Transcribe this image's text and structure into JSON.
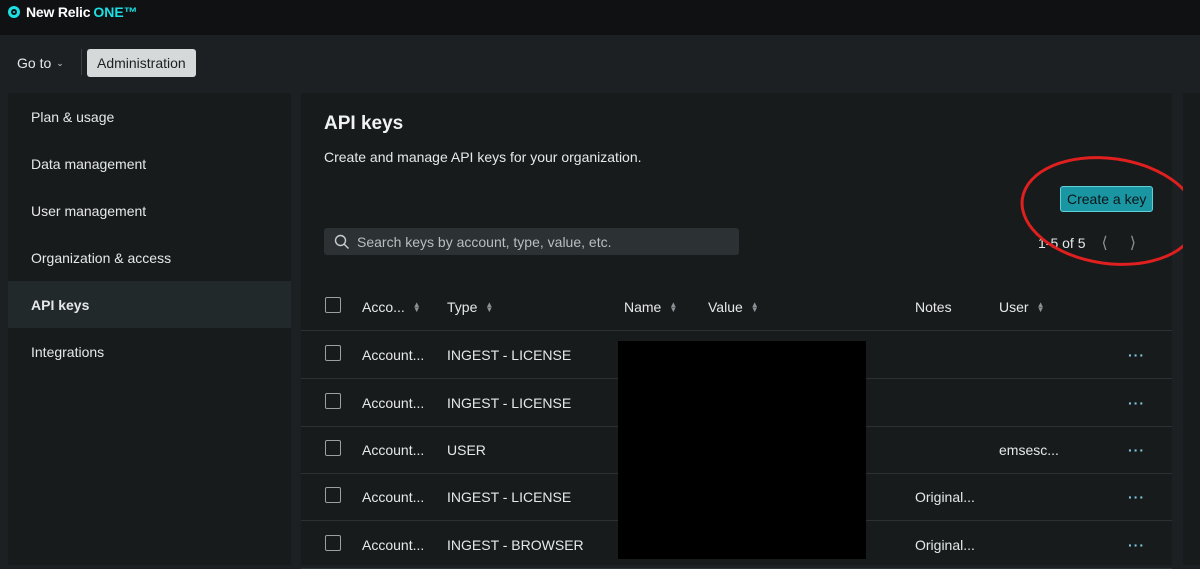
{
  "brand": {
    "name": "New Relic",
    "suffix": "ONE™",
    "accent": "#1ce0e5"
  },
  "nav": {
    "goto_label": "Go to",
    "admin_label": "Administration"
  },
  "sidebar": {
    "items": [
      {
        "label": "Plan & usage"
      },
      {
        "label": "Data management"
      },
      {
        "label": "User management"
      },
      {
        "label": "Organization & access"
      },
      {
        "label": "API keys"
      },
      {
        "label": "Integrations"
      }
    ],
    "active": "API keys"
  },
  "main": {
    "title": "API keys",
    "description": "Create and manage API keys for your organization.",
    "create_button": "Create a key",
    "search_placeholder": "Search keys by account, type, value, etc.",
    "pagination": "1-5 of 5",
    "annotation_color": "#e01f1f"
  },
  "table": {
    "headers": {
      "account": "Acco...",
      "type": "Type",
      "name": "Name",
      "value": "Value",
      "notes": "Notes",
      "user": "User"
    },
    "rows": [
      {
        "account": "Account...",
        "type": "INGEST - LICENSE",
        "notes": "",
        "user": "",
        "more": "···"
      },
      {
        "account": "Account...",
        "type": "INGEST - LICENSE",
        "notes": "",
        "user": "",
        "more": "···"
      },
      {
        "account": "Account...",
        "type": "USER",
        "notes": "",
        "user": "emsesc...",
        "more": "···"
      },
      {
        "account": "Account...",
        "type": "INGEST - LICENSE",
        "notes": "Original...",
        "user": "",
        "more": "···"
      },
      {
        "account": "Account...",
        "type": "INGEST - BROWSER",
        "notes": "Original...",
        "user": "",
        "more": "···"
      }
    ]
  }
}
